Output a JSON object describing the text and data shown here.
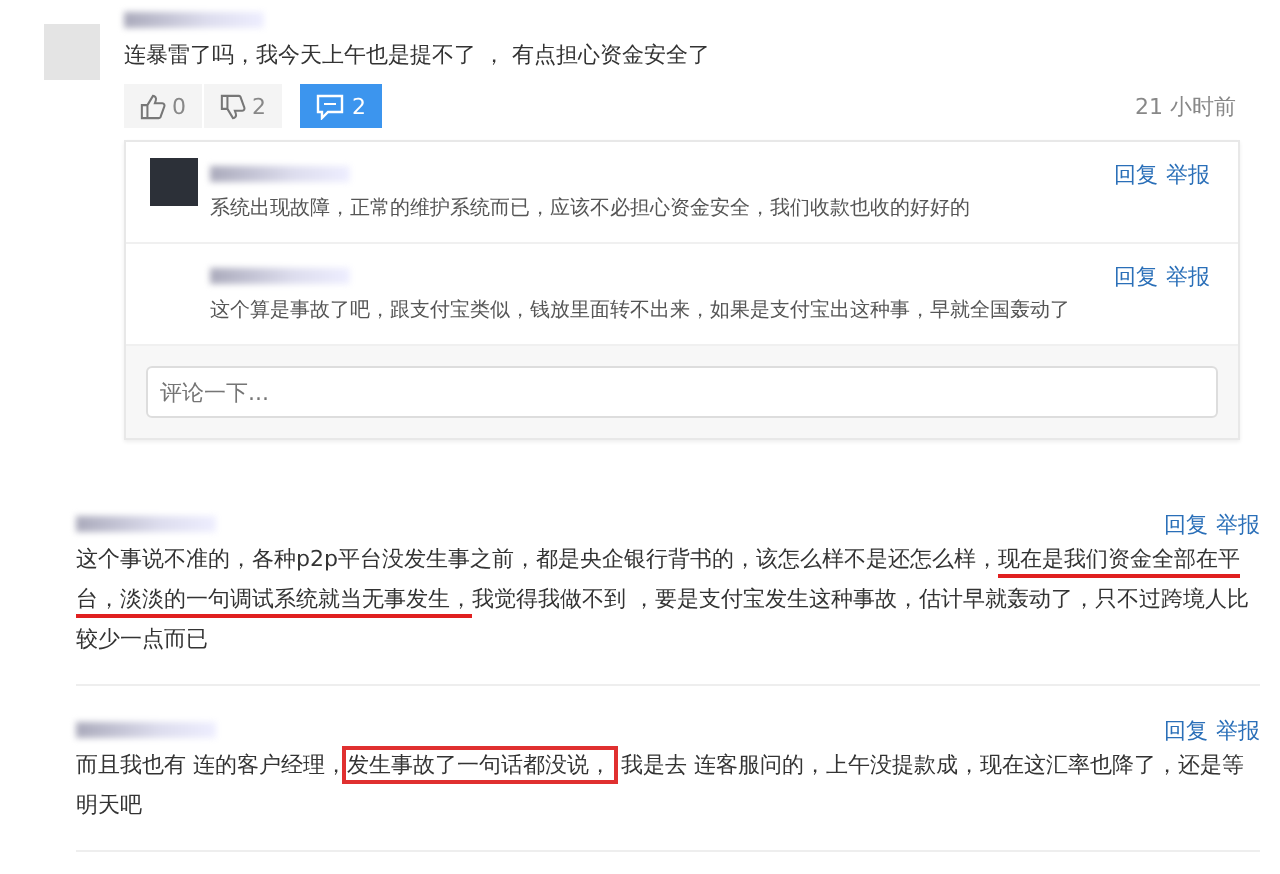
{
  "comments": [
    {
      "text": "连暴雷了吗，我今天上午也是提不了 ， 有点担心资金安全了",
      "likes": "0",
      "dislikes": "2",
      "replies_count": "2",
      "replies_open": true,
      "time": "21 小时前",
      "replies": [
        {
          "avatar": true,
          "text": "系统出现故障，正常的维护系统而已，应该不必担心资金安全，我们收款也收的好好的",
          "actions": [
            "回复",
            "举报"
          ]
        },
        {
          "avatar": false,
          "text": "这个算是事故了吧，跟支付宝类似，钱放里面转不出来，如果是支付宝出这种事，早就全国轰动了",
          "actions": [
            "回复",
            "举报"
          ]
        }
      ],
      "reply_input": {
        "placeholder": "评论一下..."
      }
    },
    {
      "actions": [
        "回复",
        "举报"
      ],
      "text": [
        {
          "text": "这个事说不准的，各种p2p平台没发生事之前，都是央企银行背书的，该怎么样不是还怎么样，",
          "underlined": false,
          "boxed": false
        },
        {
          "text": "现在是我们资金全部在平台，",
          "underlined": true,
          "boxed": false
        },
        {
          "text": "淡淡的一句调试系统就当无事发生，",
          "underlined": true,
          "boxed": false
        },
        {
          "text": "我觉得我做不到 ，要是支付宝发生这种事故，估计早就轰动了，只不过跨境人比较少一点而已",
          "underlined": false,
          "boxed": false
        }
      ]
    },
    {
      "actions": [
        "回复",
        "举报"
      ],
      "text": [
        {
          "text": "而且我也有 连的客户经理，",
          "underlined": false,
          "boxed": false
        },
        {
          "text": "发生事故了一句话都没说，",
          "underlined": false,
          "boxed": true
        },
        {
          "text": "我是去 连客服问的，上午没提款成，现在这汇率也降了，还是等明天吧",
          "underlined": false,
          "boxed": false
        }
      ]
    }
  ]
}
